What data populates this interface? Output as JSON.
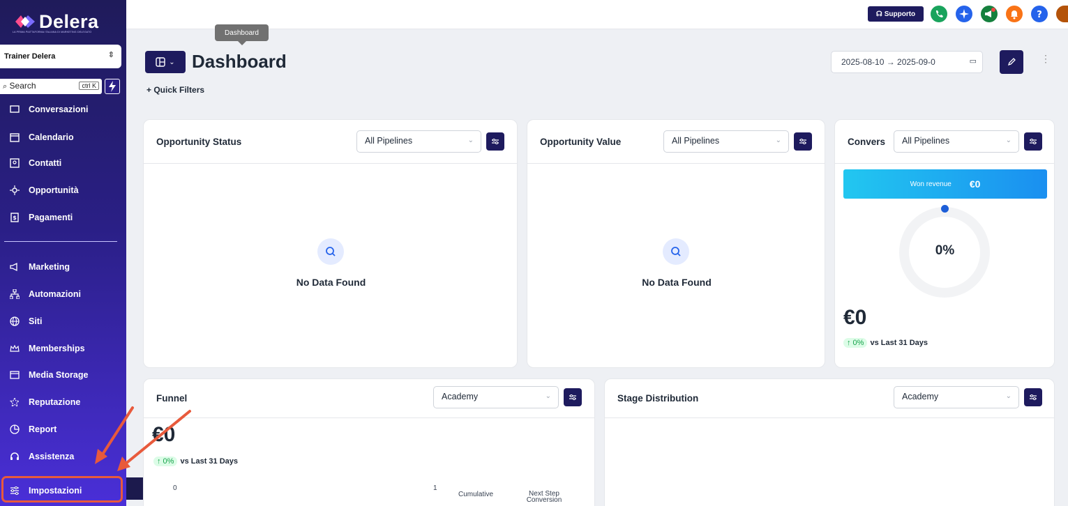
{
  "brand": {
    "name": "Delera",
    "tagline": "LA PRIMA PIATTAFORMA ITALIANA DI MARKETING DELEGATO"
  },
  "sidebar": {
    "account": "Trainer Delera",
    "search_label": "Search",
    "search_shortcut": "ctrl K",
    "items": [
      {
        "label": "Conversazioni",
        "icon": "chat-icon"
      },
      {
        "label": "Calendario",
        "icon": "calendar-icon"
      },
      {
        "label": "Contatti",
        "icon": "contact-icon"
      },
      {
        "label": "Opportunità",
        "icon": "opportunity-icon"
      },
      {
        "label": "Pagamenti",
        "icon": "payment-icon"
      },
      {
        "label": "Marketing",
        "icon": "megaphone-icon"
      },
      {
        "label": "Automazioni",
        "icon": "automation-icon"
      },
      {
        "label": "Siti",
        "icon": "globe-icon"
      },
      {
        "label": "Memberships",
        "icon": "crown-icon"
      },
      {
        "label": "Media Storage",
        "icon": "storage-icon"
      },
      {
        "label": "Reputazione",
        "icon": "star-icon"
      },
      {
        "label": "Report",
        "icon": "chart-icon"
      },
      {
        "label": "Assistenza",
        "icon": "headset-icon"
      },
      {
        "label": "Impostazioni",
        "icon": "sliders-icon"
      }
    ]
  },
  "topbar": {
    "support_label": "Supporto"
  },
  "tooltip": "Dashboard",
  "header": {
    "title": "Dashboard",
    "quick_filters": "+ Quick Filters",
    "date_range": "2025-08-10  →  2025-09-0"
  },
  "cards": {
    "opp_status": {
      "title": "Opportunity Status",
      "select": "All Pipelines",
      "empty": "No Data Found"
    },
    "opp_value": {
      "title": "Opportunity Value",
      "select": "All Pipelines",
      "empty": "No Data Found"
    },
    "conversion": {
      "title": "Convers",
      "select": "All Pipelines",
      "won_label": "Won revenue",
      "won_value": "€0",
      "percent": "0%",
      "total": "€0",
      "change": "↑ 0%",
      "change_suffix": "vs Last 31 Days"
    },
    "funnel": {
      "title": "Funnel",
      "select": "Academy",
      "total": "€0",
      "change": "↑ 0%",
      "change_suffix": "vs Last 31 Days",
      "axis_0": "0",
      "axis_1": "1",
      "col_cumulative": "Cumulative",
      "col_next": "Next Step Conversion"
    },
    "stage": {
      "title": "Stage Distribution",
      "select": "Academy"
    }
  },
  "colors": {
    "accent": "#1e1b5e",
    "annotation": "#e85a3c",
    "won_gradient_start": "#22c7f0",
    "won_gradient_end": "#1a8ff0"
  }
}
